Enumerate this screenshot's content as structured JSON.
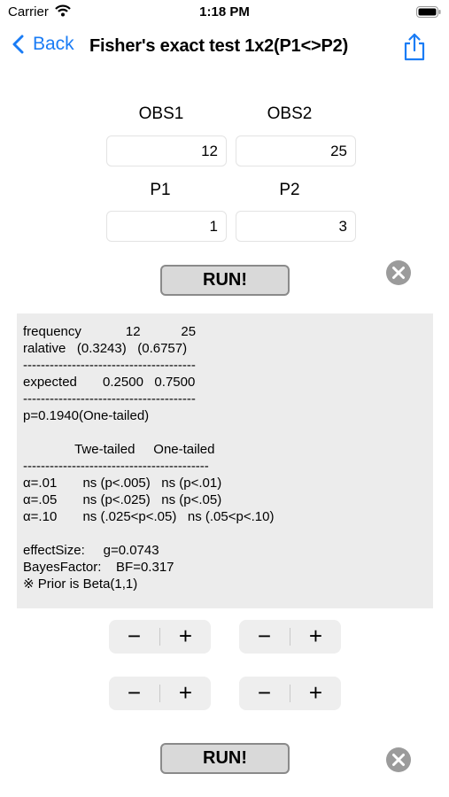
{
  "status": {
    "carrier": "Carrier",
    "time": "1:18 PM"
  },
  "nav": {
    "back_label": "Back",
    "title": "Fisher's exact test 1x2(P1<>P2)"
  },
  "inputs": {
    "obs1_label": "OBS1",
    "obs2_label": "OBS2",
    "obs1_value": "12",
    "obs2_value": "25",
    "p1_label": "P1",
    "p2_label": "P2",
    "p1_value": "1",
    "p2_value": "3"
  },
  "run_label": "RUN!",
  "result_text": "frequency            12           25\nralative   (0.3243)   (0.6757)\n---------------------------------------\nexpected       0.2500   0.7500\n---------------------------------------\np=0.1940(One-tailed)\n\n              Twe-tailed     One-tailed\n------------------------------------------\nα=.01       ns (p<.005)   ns (p<.01)\nα=.05       ns (p<.025)   ns (p<.05)\nα=.10       ns (.025<p<.05)   ns (.05<p<.10)\n\neffectSize:     g=0.0743\nBayesFactor:    BF=0.317\n※ Prior is Beta(1,1)",
  "stepper": {
    "minus": "−",
    "plus": "+"
  },
  "icons": {
    "back": "chevron-left-icon",
    "share": "share-icon",
    "clear": "x-circle-icon"
  },
  "colors": {
    "accent": "#1a7cf5",
    "result_bg": "#ececec"
  }
}
